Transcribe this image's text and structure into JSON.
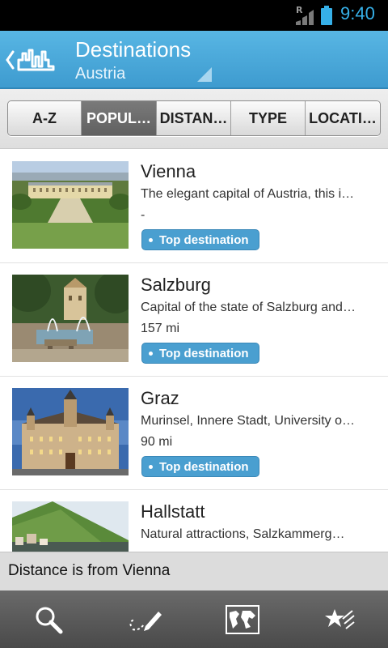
{
  "status_bar": {
    "roaming": "R",
    "time": "9:40"
  },
  "header": {
    "title": "Destinations",
    "subtitle": "Austria"
  },
  "tabs": [
    {
      "label": "A-Z",
      "active": false
    },
    {
      "label": "POPUL…",
      "active": true
    },
    {
      "label": "DISTAN…",
      "active": false
    },
    {
      "label": "TYPE",
      "active": false
    },
    {
      "label": "LOCATI…",
      "active": false
    }
  ],
  "list": {
    "items": [
      {
        "name": "Vienna",
        "description": "The elegant capital of Austria, this i…",
        "distance": "-",
        "badge": "Top destination"
      },
      {
        "name": "Salzburg",
        "description": "Capital of the state of Salzburg and…",
        "distance": "157 mi",
        "badge": "Top destination"
      },
      {
        "name": "Graz",
        "description": "Murinsel, Innere Stadt, University o…",
        "distance": "90 mi",
        "badge": "Top destination"
      },
      {
        "name": "Hallstatt",
        "description": "Natural attractions, Salzkammerg…",
        "distance": "",
        "badge": ""
      }
    ]
  },
  "footer_note": "Distance is from Vienna",
  "bottom_nav": [
    {
      "icon": "search-icon"
    },
    {
      "icon": "write-review-icon"
    },
    {
      "icon": "world-map-icon"
    },
    {
      "icon": "favorites-star-icon"
    }
  ],
  "colors": {
    "accent": "#4a9fd0",
    "header": "#3e9bcf",
    "status_time": "#36b0e8"
  }
}
